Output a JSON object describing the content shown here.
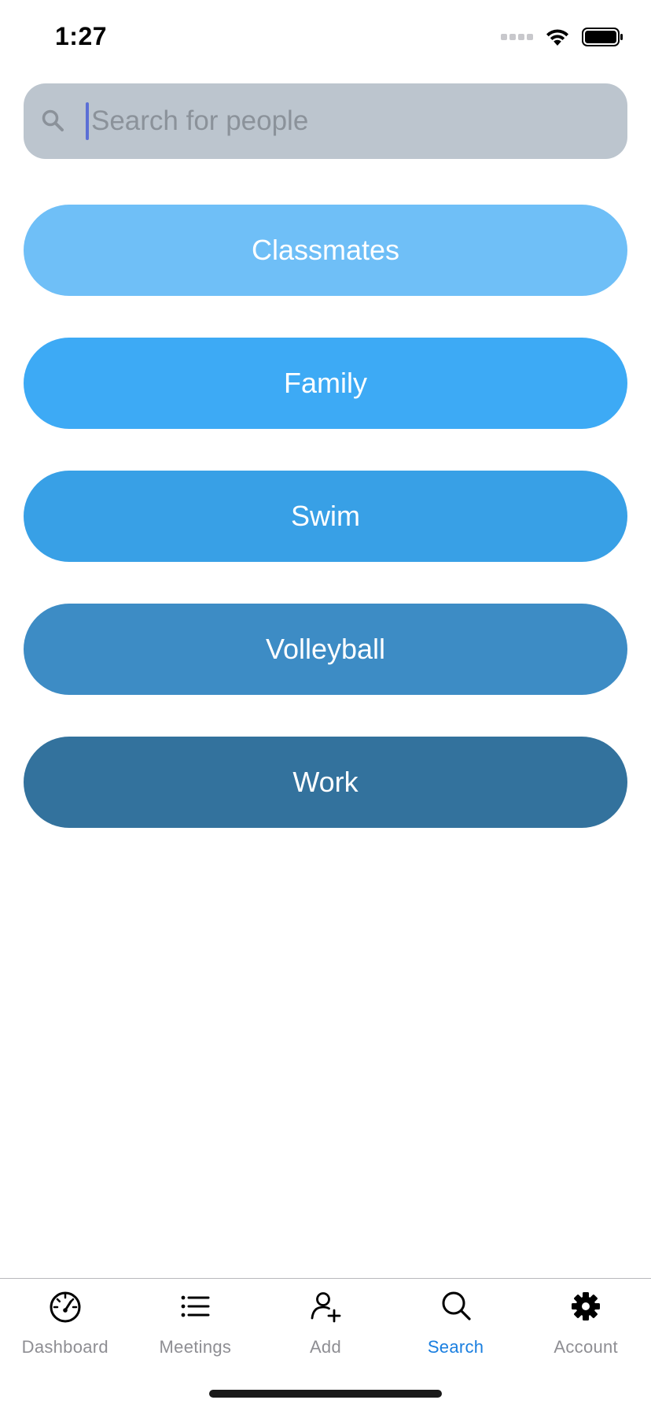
{
  "status_bar": {
    "time": "1:27"
  },
  "search": {
    "placeholder": "Search for people",
    "value": ""
  },
  "groups": [
    {
      "label": "Classmates",
      "color": "#6fbff7"
    },
    {
      "label": "Family",
      "color": "#3daaf5"
    },
    {
      "label": "Swim",
      "color": "#38a0e6"
    },
    {
      "label": "Volleyball",
      "color": "#3d8cc5"
    },
    {
      "label": "Work",
      "color": "#33729d"
    }
  ],
  "tab_bar": {
    "active": "Search",
    "active_color": "#1a7fe0",
    "inactive_color": "#8e8e93",
    "tabs": [
      {
        "label": "Dashboard",
        "icon": "speedometer-icon"
      },
      {
        "label": "Meetings",
        "icon": "list-icon"
      },
      {
        "label": "Add",
        "icon": "add-person-icon"
      },
      {
        "label": "Search",
        "icon": "search-icon"
      },
      {
        "label": "Account",
        "icon": "gear-icon"
      }
    ]
  }
}
